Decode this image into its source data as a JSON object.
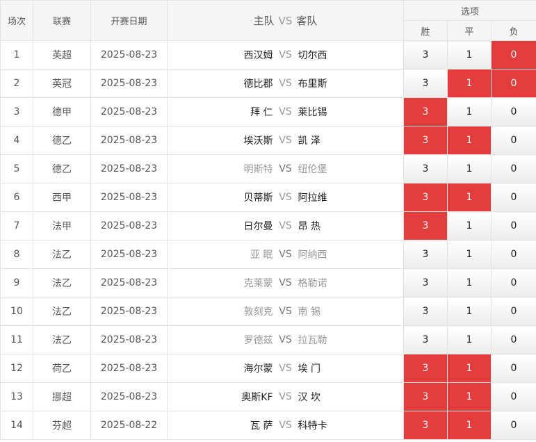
{
  "header": {
    "index": "场次",
    "league": "联赛",
    "date": "开赛日期",
    "home": "主队",
    "vs": "VS",
    "away": "客队",
    "options": "选项",
    "win": "胜",
    "draw": "平",
    "lose": "负"
  },
  "colors": {
    "selected": "#e23c3c",
    "header_bg": "#f5f5f5",
    "muted_text": "#999999"
  },
  "rows": [
    {
      "index": "1",
      "league": "英超",
      "date": "2025-08-23",
      "home": "西汉姆",
      "vs": "VS",
      "away": "切尔西",
      "win": "3",
      "draw": "1",
      "lose": "0",
      "selected": [
        false,
        false,
        true
      ],
      "dim": false
    },
    {
      "index": "2",
      "league": "英冠",
      "date": "2025-08-23",
      "home": "德比郡",
      "vs": "VS",
      "away": "布里斯",
      "win": "3",
      "draw": "1",
      "lose": "0",
      "selected": [
        false,
        true,
        true
      ],
      "dim": false
    },
    {
      "index": "3",
      "league": "德甲",
      "date": "2025-08-23",
      "home": "拜 仁",
      "vs": "VS",
      "away": "莱比锡",
      "win": "3",
      "draw": "1",
      "lose": "0",
      "selected": [
        true,
        false,
        false
      ],
      "dim": false
    },
    {
      "index": "4",
      "league": "德乙",
      "date": "2025-08-23",
      "home": "埃沃斯",
      "vs": "VS",
      "away": "凯 泽",
      "win": "3",
      "draw": "1",
      "lose": "0",
      "selected": [
        true,
        true,
        false
      ],
      "dim": false
    },
    {
      "index": "5",
      "league": "德乙",
      "date": "2025-08-23",
      "home": "明斯特",
      "vs": "VS",
      "away": "纽伦堡",
      "win": "3",
      "draw": "1",
      "lose": "0",
      "selected": [
        false,
        false,
        false
      ],
      "dim": true
    },
    {
      "index": "6",
      "league": "西甲",
      "date": "2025-08-23",
      "home": "贝蒂斯",
      "vs": "VS",
      "away": "阿拉维",
      "win": "3",
      "draw": "1",
      "lose": "0",
      "selected": [
        true,
        true,
        false
      ],
      "dim": false
    },
    {
      "index": "7",
      "league": "法甲",
      "date": "2025-08-23",
      "home": "日尔曼",
      "vs": "VS",
      "away": "昂 热",
      "win": "3",
      "draw": "1",
      "lose": "0",
      "selected": [
        true,
        false,
        false
      ],
      "dim": false
    },
    {
      "index": "8",
      "league": "法乙",
      "date": "2025-08-23",
      "home": "亚 眠",
      "vs": "VS",
      "away": "阿纳西",
      "win": "3",
      "draw": "1",
      "lose": "0",
      "selected": [
        false,
        false,
        false
      ],
      "dim": true
    },
    {
      "index": "9",
      "league": "法乙",
      "date": "2025-08-23",
      "home": "克莱蒙",
      "vs": "VS",
      "away": "格勒诺",
      "win": "3",
      "draw": "1",
      "lose": "0",
      "selected": [
        false,
        false,
        false
      ],
      "dim": true
    },
    {
      "index": "10",
      "league": "法乙",
      "date": "2025-08-23",
      "home": "敦刻克",
      "vs": "VS",
      "away": "南 锡",
      "win": "3",
      "draw": "1",
      "lose": "0",
      "selected": [
        false,
        false,
        false
      ],
      "dim": true
    },
    {
      "index": "11",
      "league": "法乙",
      "date": "2025-08-23",
      "home": "罗德兹",
      "vs": "VS",
      "away": "拉瓦勒",
      "win": "3",
      "draw": "1",
      "lose": "0",
      "selected": [
        false,
        false,
        false
      ],
      "dim": true
    },
    {
      "index": "12",
      "league": "荷乙",
      "date": "2025-08-23",
      "home": "海尔蒙",
      "vs": "VS",
      "away": "埃 门",
      "win": "3",
      "draw": "1",
      "lose": "0",
      "selected": [
        true,
        true,
        false
      ],
      "dim": false
    },
    {
      "index": "13",
      "league": "挪超",
      "date": "2025-08-23",
      "home": "奥斯KF",
      "vs": "VS",
      "away": "汉 坎",
      "win": "3",
      "draw": "1",
      "lose": "0",
      "selected": [
        true,
        true,
        false
      ],
      "dim": false
    },
    {
      "index": "14",
      "league": "芬超",
      "date": "2025-08-22",
      "home": "瓦 萨",
      "vs": "VS",
      "away": "科特卡",
      "win": "3",
      "draw": "1",
      "lose": "0",
      "selected": [
        true,
        true,
        false
      ],
      "dim": false
    }
  ]
}
